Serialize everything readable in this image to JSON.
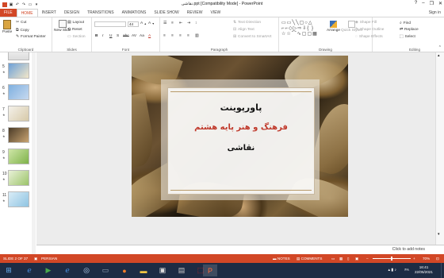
{
  "window": {
    "title": "نقاشی.ppt [Compatibility Mode] - PowerPoint",
    "controls": {
      "help": "?",
      "minimize": "–",
      "restore": "❐",
      "close": "✕"
    }
  },
  "ribbon_tabs": [
    "FILE",
    "HOME",
    "INSERT",
    "DESIGN",
    "TRANSITIONS",
    "ANIMATIONS",
    "SLIDE SHOW",
    "REVIEW",
    "VIEW"
  ],
  "sign_in": "Sign in",
  "clipboard": {
    "paste": "Paste",
    "cut": "Cut",
    "copy": "Copy",
    "format_painter": "Format Painter",
    "label": "Clipboard"
  },
  "slides_group": {
    "new_slide": "New Slide",
    "layout": "Layout",
    "reset": "Reset",
    "section": "Section",
    "label": "Slides"
  },
  "font_group": {
    "size": "44",
    "label": "Font",
    "buttons": [
      "B",
      "I",
      "U",
      "S",
      "abc",
      "AV",
      "Aa",
      "A"
    ]
  },
  "paragraph_group": {
    "text_direction": "Text Direction",
    "align_text": "Align Text",
    "convert_smartart": "Convert to SmartArt",
    "label": "Paragraph"
  },
  "drawing_group": {
    "arrange": "Arrange",
    "quick_styles": "Quick Styles",
    "shape_fill": "Shape Fill",
    "shape_outline": "Shape Outline",
    "shape_effects": "Shape Effects",
    "label": "Drawing"
  },
  "editing_group": {
    "find": "Find",
    "replace": "Replace",
    "select": "Select",
    "label": "Editing"
  },
  "thumbnails": [
    {
      "num": "5"
    },
    {
      "num": "6"
    },
    {
      "num": "7"
    },
    {
      "num": "8"
    },
    {
      "num": "9"
    },
    {
      "num": "10"
    },
    {
      "num": "11"
    }
  ],
  "slide": {
    "title": "پاورپوینت",
    "subtitle": "فرهنگ و هنر پایه هشتم",
    "third": "نقاشی"
  },
  "notes_placeholder": "Click to add notes",
  "status": {
    "slide": "SLIDE 2 OF 37",
    "language": "PERSIAN",
    "notes": "NOTES",
    "comments": "COMMENTS",
    "zoom": "70%"
  },
  "taskbar": {
    "lang": "FA",
    "time": "16:41",
    "date": "22/05/2021"
  },
  "colors": {
    "accent": "#d24726",
    "taskbar": "#1d2c44"
  }
}
